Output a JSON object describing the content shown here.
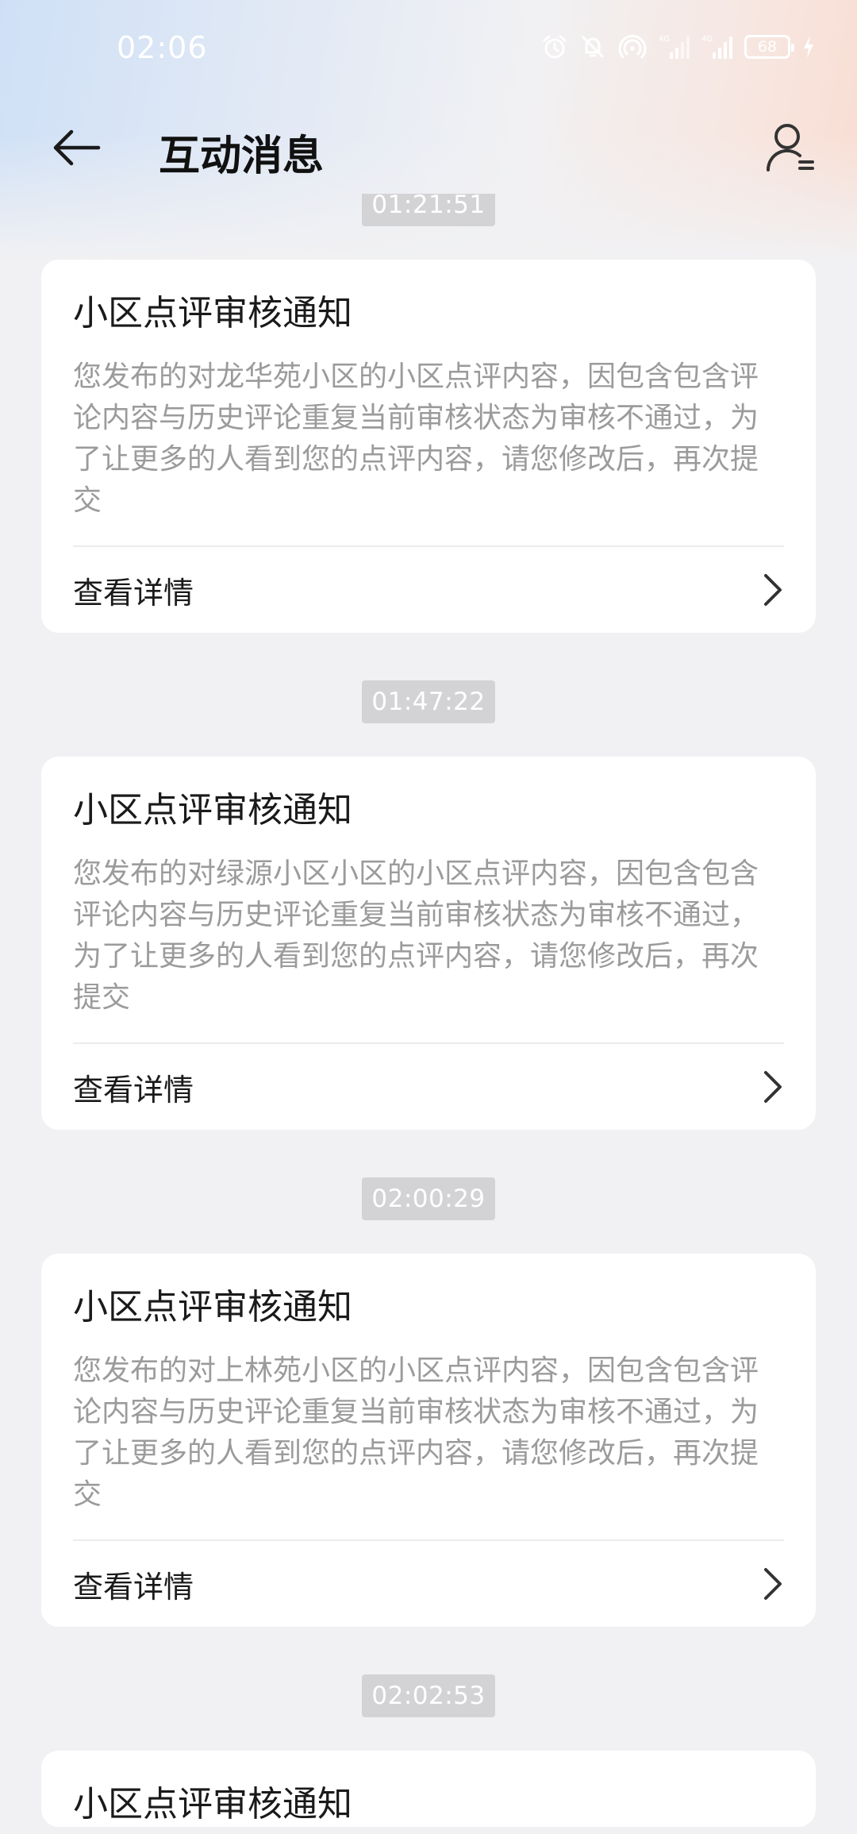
{
  "status_bar": {
    "time": "02:06",
    "battery": "68",
    "icons": [
      "alarm-icon",
      "mute-icon",
      "hotspot-icon",
      "signal-icon",
      "signal-icon",
      "charging-icon"
    ]
  },
  "header": {
    "title": "互动消息",
    "back_icon": "arrow-left-icon",
    "profile_icon": "user-settings-icon"
  },
  "messages": [
    {
      "time": "01:21:51",
      "title": "小区点评审核通知",
      "body": "您发布的对龙华苑小区的小区点评内容，因包含包含评论内容与历史评论重复当前审核状态为审核不通过，为了让更多的人看到您的点评内容，请您修改后，再次提交",
      "action": "查看详情"
    },
    {
      "time": "01:47:22",
      "title": "小区点评审核通知",
      "body": "您发布的对绿源小区小区的小区点评内容，因包含包含评论内容与历史评论重复当前审核状态为审核不通过，为了让更多的人看到您的点评内容，请您修改后，再次提交",
      "action": "查看详情"
    },
    {
      "time": "02:00:29",
      "title": "小区点评审核通知",
      "body": "您发布的对上林苑小区的小区点评内容，因包含包含评论内容与历史评论重复当前审核状态为审核不通过，为了让更多的人看到您的点评内容，请您修改后，再次提交",
      "action": "查看详情"
    },
    {
      "time": "02:02:53",
      "title": "小区点评审核通知",
      "body": "",
      "action": ""
    }
  ]
}
